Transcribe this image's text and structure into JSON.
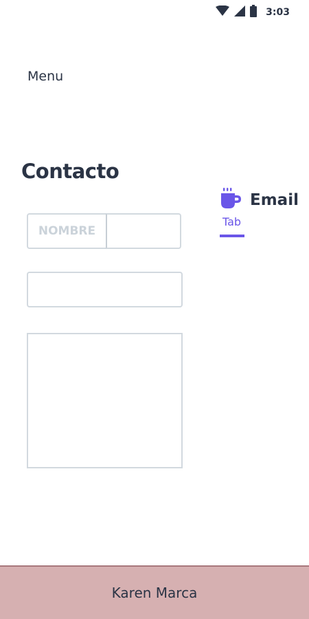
{
  "status_bar": {
    "time": "3:03",
    "icons": [
      "wifi-icon",
      "signal-icon",
      "battery-icon"
    ]
  },
  "menu": {
    "label": "Menu"
  },
  "page": {
    "title": "Contacto"
  },
  "form": {
    "name_prefix": "NOMBRE",
    "name_value": "",
    "email_value": "",
    "message_value": ""
  },
  "tab": {
    "icon": "coffee-cup-icon",
    "title": "Email",
    "subtitle": "Tab",
    "accent_color": "#6a56e8"
  },
  "footer": {
    "name": "Karen Marca",
    "background_color": "#d6b0b1"
  }
}
